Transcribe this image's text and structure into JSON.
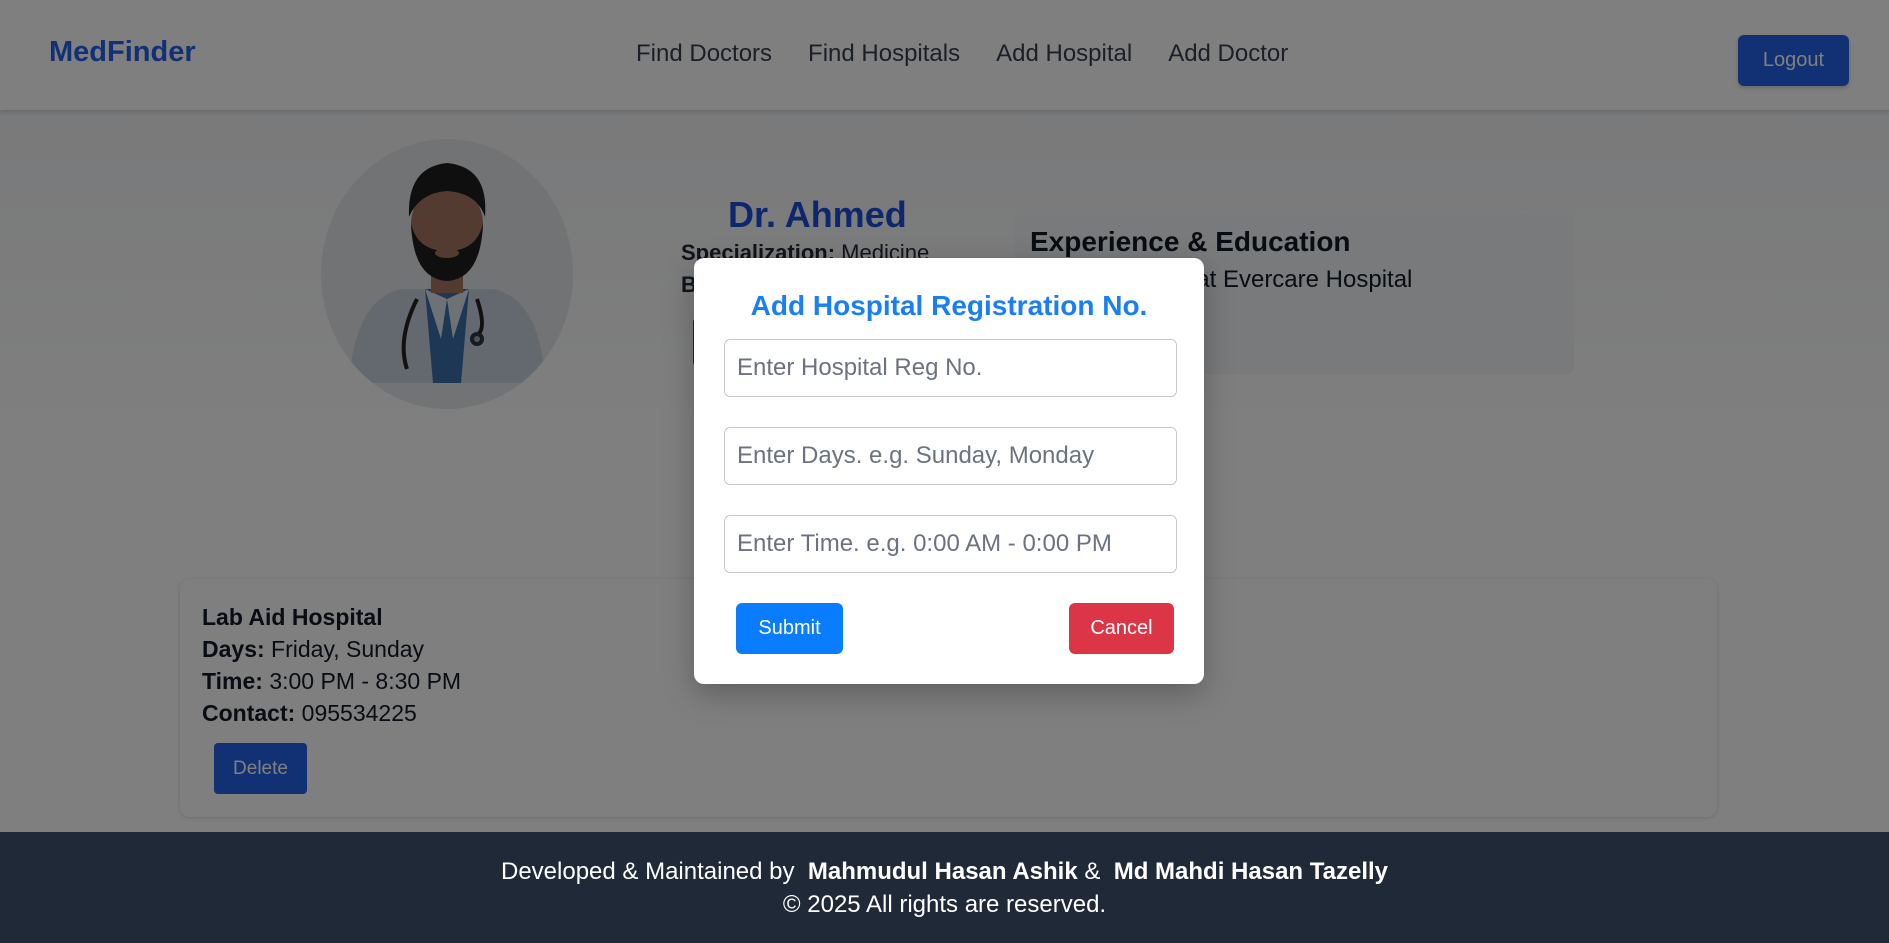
{
  "navbar": {
    "brand": "MedFinder",
    "links": [
      "Find Doctors",
      "Find Hospitals",
      "Add Hospital",
      "Add Doctor"
    ],
    "logout_label": "Logout"
  },
  "doctor": {
    "name": "Dr. Ahmed",
    "specialization_label": "Specialization:",
    "specialization_value": "Medicine",
    "partial_label": "B",
    "experience_title": "Experience & Education",
    "experience_text": "Medical Officer at Evercare Hospital"
  },
  "hospital_entry": {
    "name": "Lab Aid Hospital",
    "days_label": "Days:",
    "days_value": "Friday, Sunday",
    "time_label": "Time:",
    "time_value": "3:00 PM - 8:30 PM",
    "contact_label": "Contact:",
    "contact_value": "095534225",
    "delete_label": "Delete"
  },
  "modal": {
    "title": "Add Hospital Registration No.",
    "reg_placeholder": "Enter Hospital Reg No.",
    "days_placeholder": "Enter Days. e.g. Sunday, Monday",
    "time_placeholder": "Enter Time. e.g. 0:00 AM - 0:00 PM",
    "submit_label": "Submit",
    "cancel_label": "Cancel"
  },
  "footer": {
    "prefix": "Developed & Maintained by",
    "author1": "Mahmudul Hasan Ashik",
    "separator": "&",
    "author2": "Md Mahdi Hasan Tazelly",
    "copyright": "© 2025 All rights are reserved."
  },
  "colors": {
    "brand": "#2563eb",
    "modal_title": "#1a7ef7",
    "submit": "#0a7cff",
    "cancel": "#dc3545",
    "footer_bg": "#1f2937"
  }
}
